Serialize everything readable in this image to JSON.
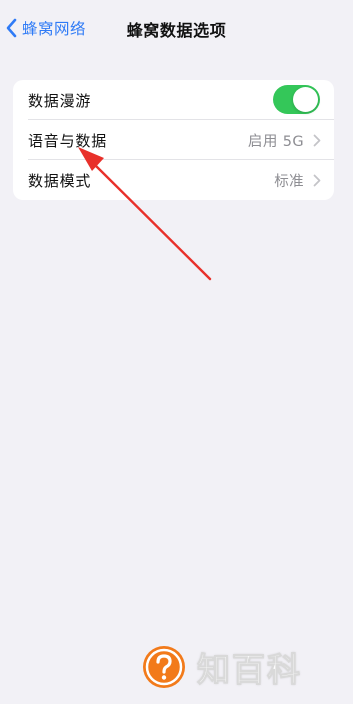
{
  "nav": {
    "back_label": "蜂窝网络",
    "title": "蜂窝数据选项"
  },
  "settings": {
    "rows": [
      {
        "label": "数据漫游",
        "control": "toggle",
        "toggle_on": true
      },
      {
        "label": "语音与数据",
        "value": "启用 5G",
        "control": "chevron"
      },
      {
        "label": "数据模式",
        "value": "标准",
        "control": "chevron"
      }
    ]
  },
  "watermark": {
    "text": "知百科"
  },
  "colors": {
    "background": "#f2f1f6",
    "accent_blue": "#2f7bf6",
    "toggle_green": "#34c759",
    "secondary_text": "#8e8e93",
    "annotation_red": "#e8302a",
    "watermark_orange": "#f27a1a"
  },
  "icons": {
    "back": "chevron-left-icon",
    "row_disclosure": "chevron-right-icon",
    "annotation": "red-arrow",
    "watermark_logo": "question-mark-bubble-icon"
  }
}
